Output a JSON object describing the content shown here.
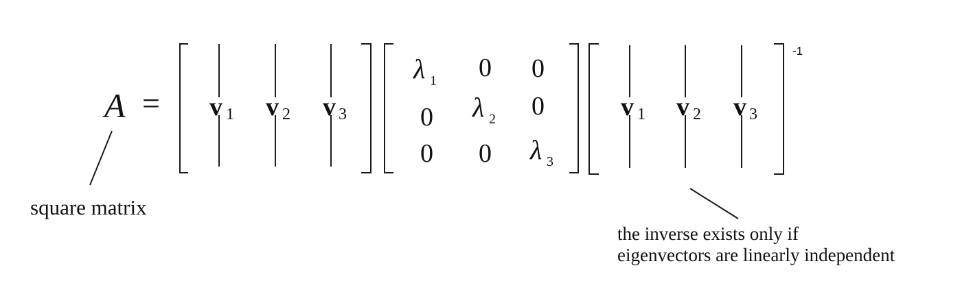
{
  "equation": {
    "lhs": "A",
    "equals": "=",
    "eigenvector_matrix": {
      "columns": [
        {
          "symbol": "v",
          "subscript": "1"
        },
        {
          "symbol": "v",
          "subscript": "2"
        },
        {
          "symbol": "v",
          "subscript": "3"
        }
      ]
    },
    "eigenvalue_matrix": {
      "rows": [
        [
          {
            "text": "λ",
            "sub": "1"
          },
          {
            "text": "0",
            "sub": ""
          },
          {
            "text": "0",
            "sub": ""
          }
        ],
        [
          {
            "text": "0",
            "sub": ""
          },
          {
            "text": "λ",
            "sub": "2"
          },
          {
            "text": "0",
            "sub": ""
          }
        ],
        [
          {
            "text": "0",
            "sub": ""
          },
          {
            "text": "0",
            "sub": ""
          },
          {
            "text": "λ",
            "sub": "3"
          }
        ]
      ]
    },
    "inverse_matrix": {
      "columns": [
        {
          "symbol": "v",
          "subscript": "1"
        },
        {
          "symbol": "v",
          "subscript": "2"
        },
        {
          "symbol": "v",
          "subscript": "3"
        }
      ],
      "exponent": "-1"
    }
  },
  "annotations": {
    "square_matrix": "square matrix",
    "inverse_note_line1": "the inverse exists only if",
    "inverse_note_line2": "eigenvectors are linearly independent"
  },
  "colors": {
    "ink": "#111111",
    "background": "#ffffff"
  }
}
